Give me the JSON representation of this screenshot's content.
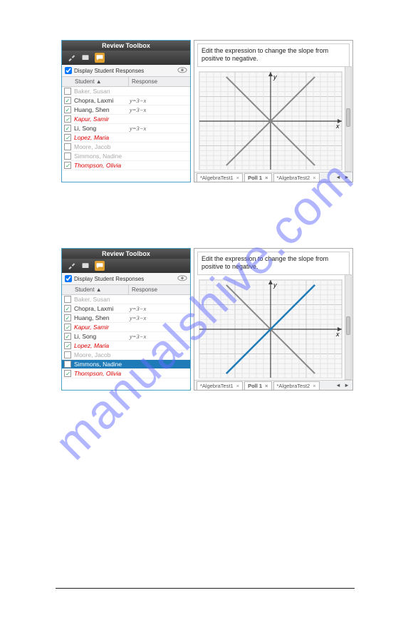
{
  "watermark": "manualshive.com",
  "panel1": {
    "title": "Review Toolbox",
    "display_label": "Display Student Responses",
    "col_student": "Student ▲",
    "col_response": "Response",
    "rows": [
      {
        "name": "Baker, Susan",
        "resp": "",
        "cls": "gray",
        "chk": false
      },
      {
        "name": "Chopra, Laxmi",
        "resp": "y=3−x",
        "cls": "",
        "chk": true
      },
      {
        "name": "Huang, Shen",
        "resp": "y=3−x",
        "cls": "",
        "chk": true
      },
      {
        "name": "Kapur, Samir",
        "resp": "",
        "cls": "red",
        "chk": true
      },
      {
        "name": "Li, Song",
        "resp": "y=3−x",
        "cls": "",
        "chk": true
      },
      {
        "name": "Lopez, Maria",
        "resp": "",
        "cls": "red",
        "chk": true
      },
      {
        "name": "Moore, Jacob",
        "resp": "",
        "cls": "gray",
        "chk": false
      },
      {
        "name": "Simmons, Nadine",
        "resp": "",
        "cls": "gray",
        "chk": false
      },
      {
        "name": "Thompson, Olivia",
        "resp": "",
        "cls": "red",
        "chk": true
      }
    ],
    "prompt": "Edit the expression to change the slope from positive to negative.",
    "tabs": [
      {
        "label": "*AlgebraTest1",
        "active": false
      },
      {
        "label": "Poll 1",
        "active": true
      },
      {
        "label": "*AlgebraTest2",
        "active": false
      }
    ],
    "plot": {
      "show_blue": false
    }
  },
  "panel2": {
    "title": "Review Toolbox",
    "display_label": "Display Student Responses",
    "col_student": "Student ▲",
    "col_response": "Response",
    "rows": [
      {
        "name": "Baker, Susan",
        "resp": "",
        "cls": "gray",
        "chk": false
      },
      {
        "name": "Chopra, Laxmi",
        "resp": "y=3−x",
        "cls": "",
        "chk": true
      },
      {
        "name": "Huang, Shen",
        "resp": "y=3−x",
        "cls": "",
        "chk": true
      },
      {
        "name": "Kapur, Samir",
        "resp": "",
        "cls": "red",
        "chk": true
      },
      {
        "name": "Li, Song",
        "resp": "y=3−x",
        "cls": "",
        "chk": true
      },
      {
        "name": "Lopez, Maria",
        "resp": "",
        "cls": "red",
        "chk": true
      },
      {
        "name": "Moore, Jacob",
        "resp": "",
        "cls": "gray",
        "chk": false
      },
      {
        "name": "Simmons, Nadine",
        "resp": "",
        "cls": "sel",
        "chk": false
      },
      {
        "name": "Thompson, Olivia",
        "resp": "",
        "cls": "red",
        "chk": true
      }
    ],
    "prompt": "Edit the expression to change the slope from positive to negative.",
    "tabs": [
      {
        "label": "*AlgebraTest1",
        "active": false
      },
      {
        "label": "Poll 1",
        "active": true
      },
      {
        "label": "*AlgebraTest2",
        "active": false
      }
    ],
    "plot": {
      "show_blue": true
    }
  }
}
